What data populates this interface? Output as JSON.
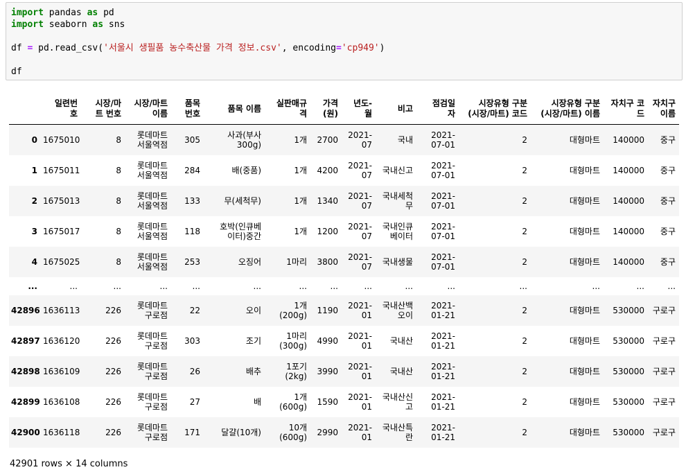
{
  "code_cell": {
    "lines": [
      [
        {
          "t": "import",
          "c": "kw"
        },
        {
          "t": " pandas ",
          "c": ""
        },
        {
          "t": "as",
          "c": "kw"
        },
        {
          "t": " pd",
          "c": ""
        }
      ],
      [
        {
          "t": "import",
          "c": "kw"
        },
        {
          "t": " seaborn ",
          "c": ""
        },
        {
          "t": "as",
          "c": "kw"
        },
        {
          "t": " sns",
          "c": ""
        }
      ],
      [],
      [
        {
          "t": "df ",
          "c": ""
        },
        {
          "t": "=",
          "c": "op"
        },
        {
          "t": " pd.read_csv(",
          "c": ""
        },
        {
          "t": "'서울시 생필품 농수축산물 가격 정보.csv'",
          "c": "str"
        },
        {
          "t": ", encoding",
          "c": ""
        },
        {
          "t": "=",
          "c": "op"
        },
        {
          "t": "'cp949'",
          "c": "str"
        },
        {
          "t": ")",
          "c": ""
        }
      ],
      [],
      [
        {
          "t": "df",
          "c": ""
        }
      ]
    ]
  },
  "dataframe": {
    "columns": [
      "",
      "일련번\n호",
      "시장/마\n트 번호",
      "시장/마트\n이름",
      "품목\n번호",
      "품목 이름",
      "실판매규\n격",
      "가격\n(원)",
      "년도-\n월",
      "비고",
      "점검일\n자",
      "시장유형 구분\n(시장/마트) 코드",
      "시장유형 구분\n(시장/마트) 이름",
      "자치구 코\n드",
      "자치구\n이름"
    ],
    "rows": [
      {
        "index": "0",
        "cells": [
          "1675010",
          "8",
          "롯데마트\n서울역점",
          "305",
          "사과(부사\n300g)",
          "1개",
          "2700",
          "2021-\n07",
          "국내",
          "2021-\n07-01",
          "2",
          "대형마트",
          "140000",
          "중구"
        ]
      },
      {
        "index": "1",
        "cells": [
          "1675011",
          "8",
          "롯데마트\n서울역점",
          "284",
          "배(중품)",
          "1개",
          "4200",
          "2021-\n07",
          "국내신고",
          "2021-\n07-01",
          "2",
          "대형마트",
          "140000",
          "중구"
        ]
      },
      {
        "index": "2",
        "cells": [
          "1675013",
          "8",
          "롯데마트\n서울역점",
          "133",
          "무(세척무)",
          "1개",
          "1340",
          "2021-\n07",
          "국내세척\n무",
          "2021-\n07-01",
          "2",
          "대형마트",
          "140000",
          "중구"
        ]
      },
      {
        "index": "3",
        "cells": [
          "1675017",
          "8",
          "롯데마트\n서울역점",
          "118",
          "호박(인큐베\n이터)중간",
          "1개",
          "1200",
          "2021-\n07",
          "국내인큐\n베이터",
          "2021-\n07-01",
          "2",
          "대형마트",
          "140000",
          "중구"
        ]
      },
      {
        "index": "4",
        "cells": [
          "1675025",
          "8",
          "롯데마트\n서울역점",
          "253",
          "오징어",
          "1마리",
          "3800",
          "2021-\n07",
          "국내생물",
          "2021-\n07-01",
          "2",
          "대형마트",
          "140000",
          "중구"
        ]
      },
      {
        "index": "...",
        "cells": [
          "...",
          "...",
          "...",
          "...",
          "...",
          "...",
          "...",
          "...",
          "...",
          "...",
          "...",
          "...",
          "...",
          "..."
        ]
      },
      {
        "index": "42896",
        "cells": [
          "1636113",
          "226",
          "롯데마트\n구로점",
          "22",
          "오이",
          "1개\n(200g)",
          "1190",
          "2021-\n01",
          "국내산백\n오이",
          "2021-\n01-21",
          "2",
          "대형마트",
          "530000",
          "구로구"
        ]
      },
      {
        "index": "42897",
        "cells": [
          "1636120",
          "226",
          "롯데마트\n구로점",
          "303",
          "조기",
          "1마리\n(300g)",
          "4990",
          "2021-\n01",
          "국내산",
          "2021-\n01-21",
          "2",
          "대형마트",
          "530000",
          "구로구"
        ]
      },
      {
        "index": "42898",
        "cells": [
          "1636109",
          "226",
          "롯데마트\n구로점",
          "26",
          "배추",
          "1포기\n(2kg)",
          "3990",
          "2021-\n01",
          "국내산",
          "2021-\n01-21",
          "2",
          "대형마트",
          "530000",
          "구로구"
        ]
      },
      {
        "index": "42899",
        "cells": [
          "1636108",
          "226",
          "롯데마트\n구로점",
          "27",
          "배",
          "1개\n(600g)",
          "1590",
          "2021-\n01",
          "국내산신\n고",
          "2021-\n01-21",
          "2",
          "대형마트",
          "530000",
          "구로구"
        ]
      },
      {
        "index": "42900",
        "cells": [
          "1636118",
          "226",
          "롯데마트\n구로점",
          "171",
          "달걀(10개)",
          "10개\n(600g)",
          "2990",
          "2021-\n01",
          "국내산특\n란",
          "2021-\n01-21",
          "2",
          "대형마트",
          "530000",
          "구로구"
        ]
      }
    ],
    "shape_text": "42901 rows × 14 columns"
  }
}
